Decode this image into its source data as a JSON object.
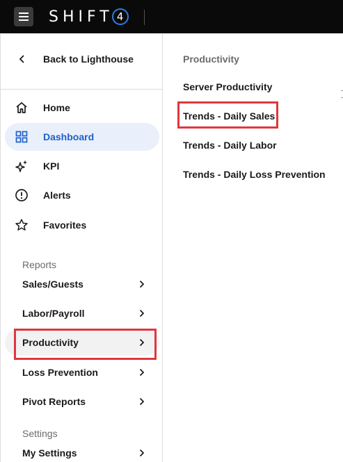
{
  "topbar": {
    "brand": "SHIFT",
    "brand_digit": "4"
  },
  "sidebar": {
    "back_label": "Back to Lighthouse",
    "nav": [
      {
        "label": "Home",
        "icon": "home-icon"
      },
      {
        "label": "Dashboard",
        "icon": "dashboard-grid-icon",
        "active": true
      },
      {
        "label": "KPI",
        "icon": "sparkle-icon"
      },
      {
        "label": "Alerts",
        "icon": "alert-circle-icon"
      },
      {
        "label": "Favorites",
        "icon": "star-icon"
      }
    ],
    "reports_title": "Reports",
    "reports": [
      {
        "label": "Sales/Guests"
      },
      {
        "label": "Labor/Payroll"
      },
      {
        "label": "Productivity",
        "selected": true
      },
      {
        "label": "Loss Prevention"
      },
      {
        "label": "Pivot Reports"
      }
    ],
    "settings_title": "Settings",
    "settings": [
      {
        "label": "My Settings"
      }
    ]
  },
  "panel": {
    "title": "Productivity",
    "links": [
      {
        "label": "Server Productivity"
      },
      {
        "label": "Trends - Daily Sales",
        "highlighted": true
      },
      {
        "label": "Trends - Daily Labor"
      },
      {
        "label": "Trends - Daily Loss Prevention"
      }
    ]
  },
  "colors": {
    "accent": "#1f5fcc",
    "active_bg": "#e9f0fb",
    "highlight": "#e0363d",
    "topbar": "#0a0a0a"
  }
}
